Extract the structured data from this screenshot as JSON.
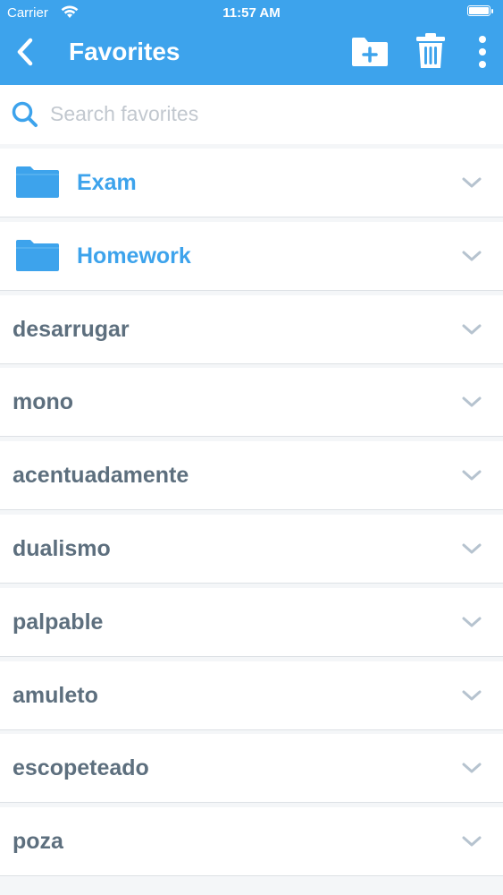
{
  "status_bar": {
    "carrier": "Carrier",
    "time": "11:57 AM"
  },
  "nav": {
    "title": "Favorites",
    "back_icon": "chevron-left-icon",
    "new_folder_icon": "folder-plus-icon",
    "delete_icon": "trash-icon",
    "more_icon": "more-vertical-icon"
  },
  "search": {
    "placeholder": "Search favorites",
    "value": ""
  },
  "folders": [
    {
      "label": "Exam"
    },
    {
      "label": "Homework"
    }
  ],
  "words": [
    {
      "label": "desarrugar"
    },
    {
      "label": "mono"
    },
    {
      "label": "acentuadamente"
    },
    {
      "label": "dualismo"
    },
    {
      "label": "palpable"
    },
    {
      "label": "amuleto"
    },
    {
      "label": "escopeteado"
    },
    {
      "label": "poza"
    }
  ],
  "colors": {
    "brand": "#3da3ec",
    "word_text": "#5d6f7e",
    "background": "#f4f6f8",
    "chevron": "#b6c3cf"
  }
}
